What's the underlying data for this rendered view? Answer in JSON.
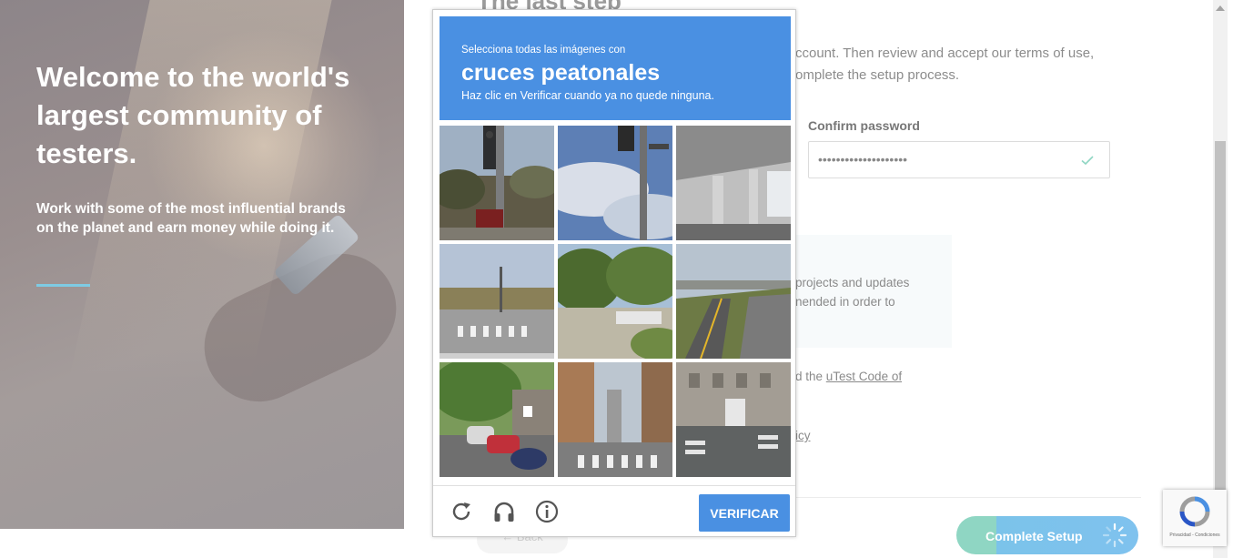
{
  "hero": {
    "title": "Welcome to the world's largest community of testers.",
    "subtitle": "Work with some of the most influential brands on the planet and earn money while doing it.",
    "accent_color": "#7ecbe3"
  },
  "form": {
    "step_title": "The last step",
    "intro": "ccount. Then review and accept our terms of use, omplete the setup process.",
    "confirm_password_label": "Confirm password",
    "confirm_password_value": "••••••••••••••••••••",
    "newsletter_text": "projects and updates nended in order to",
    "code_of_conduct_prefix": "d the ",
    "code_of_conduct_link": "uTest Code of",
    "policy_link": "icy",
    "back_label": "← Back",
    "complete_label": "Complete Setup"
  },
  "captcha": {
    "instruction_small": "Selecciona todas las imágenes con",
    "target": "cruces peatonales",
    "instruction_hint": "Haz clic en Verificar cuando ya no quede ninguna.",
    "verify_label": "VERIFICAR",
    "header_color": "#4a90e2",
    "tiles": [
      {
        "icon": "traffic-light-pole"
      },
      {
        "icon": "traffic-light-sky"
      },
      {
        "icon": "overpass"
      },
      {
        "icon": "crosswalk-intersection"
      },
      {
        "icon": "trees-parking"
      },
      {
        "icon": "highway"
      },
      {
        "icon": "street-cars-motorbike"
      },
      {
        "icon": "city-crosswalk"
      },
      {
        "icon": "building-crosswalk"
      }
    ],
    "footer_icons": [
      "reload-icon",
      "audio-headphones-icon",
      "info-icon"
    ]
  },
  "recaptcha_badge": {
    "terms": "Privacidad - Condiciones"
  }
}
